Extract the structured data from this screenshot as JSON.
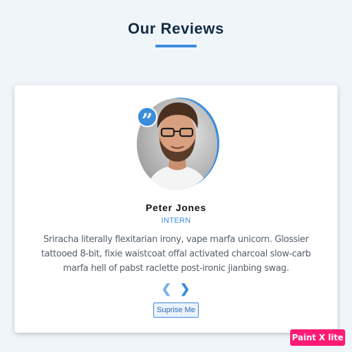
{
  "section": {
    "title": "Our Reviews"
  },
  "review": {
    "name": "Peter Jones",
    "job": "INTERN",
    "text": "Sriracha literally flexitarian irony, vape marfa unicorn. Glossier tattooed 8-bit, fixie waistcoat offal activated charcoal slow-carb marfa hell of pabst raclette post-ironic jianbing swag.",
    "avatar": "person-portrait",
    "quote_icon": "quote-icon"
  },
  "controls": {
    "prev_icon": "chevron-left-icon",
    "next_icon": "chevron-right-icon",
    "surprise_label": "Suprise Me"
  },
  "watermark": {
    "text": "Paint X lite"
  },
  "colors": {
    "accent": "#3a8ddb",
    "title": "#102a43",
    "background": "#f0f5fa",
    "card": "#ffffff",
    "watermark": "#ff1a75"
  }
}
